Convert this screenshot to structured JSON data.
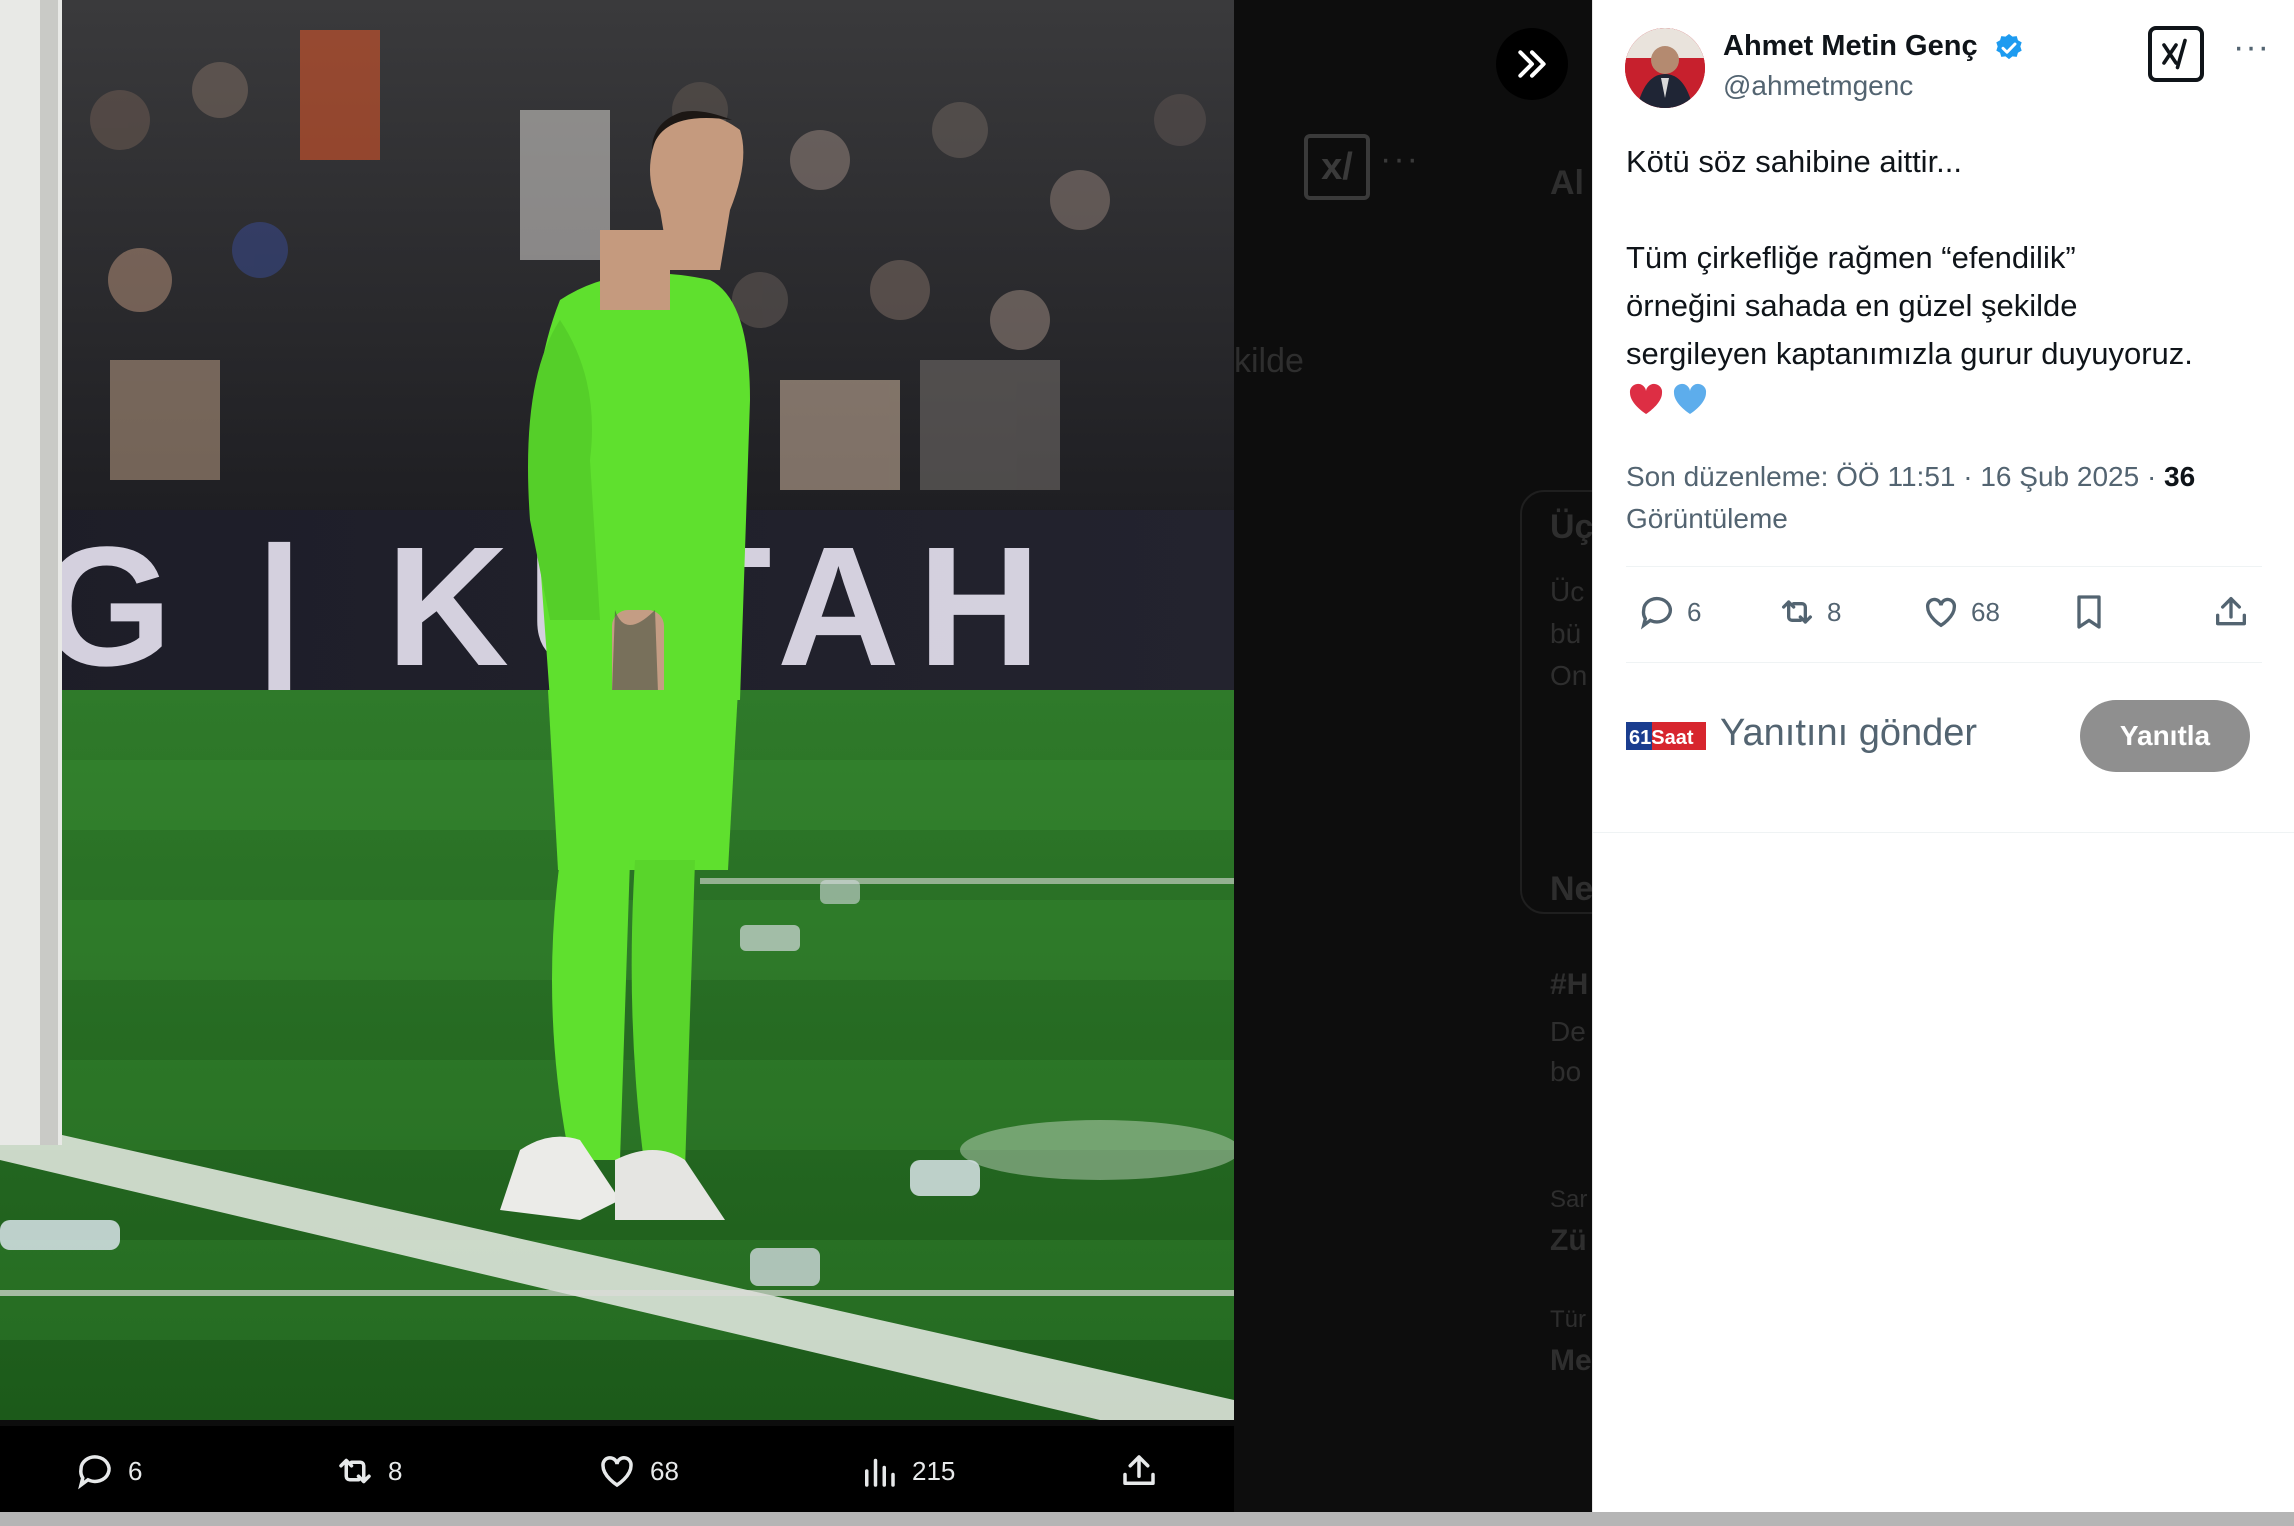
{
  "viewer": {
    "expand_icon": "double-chevron-right-icon",
    "ghost_logo": "x/",
    "ghost_more": "···",
    "ghost_texts": [
      "Al",
      "kilde",
      "Üç",
      "Üc",
      "bü",
      "On",
      "Ne",
      "#H",
      "De",
      "bo",
      "Sar",
      "Zü",
      "Tür",
      "Me"
    ],
    "photo_banner_text": "G | KUTAH",
    "actions": {
      "replies": "6",
      "retweets": "8",
      "likes": "68",
      "views": "215"
    }
  },
  "tweet": {
    "author_name": "Ahmet Metin Genç",
    "author_handle": "@ahmetmgenc",
    "grok_label": "x/",
    "more_label": "···",
    "text_line1": "Kötü söz sahibine aittir...",
    "text_line2": "Tüm çirkefliğe rağmen “efendilik”",
    "text_line3": "örneğini sahada en güzel şekilde",
    "text_line4": "sergileyen kaptanımızla gurur duyuyoruz.",
    "hearts": "❤️💙",
    "meta_prefix": "Son düzenleme: ÖÖ 11:51 · 16 Şub 2025 · ",
    "views_count": "36",
    "views_label": "Görüntüleme",
    "actions": {
      "replies": "6",
      "retweets": "8",
      "likes": "68"
    },
    "reply_logo_text": "61Saat",
    "reply_placeholder": "Yanıtını gönder",
    "reply_button": "Yanıtla"
  },
  "colors": {
    "text_primary": "#0f1419",
    "text_secondary": "#536471",
    "verified": "#1d9bf0",
    "reply_button_bg": "#8f8f8f",
    "kit_green": "#5fe02e"
  }
}
